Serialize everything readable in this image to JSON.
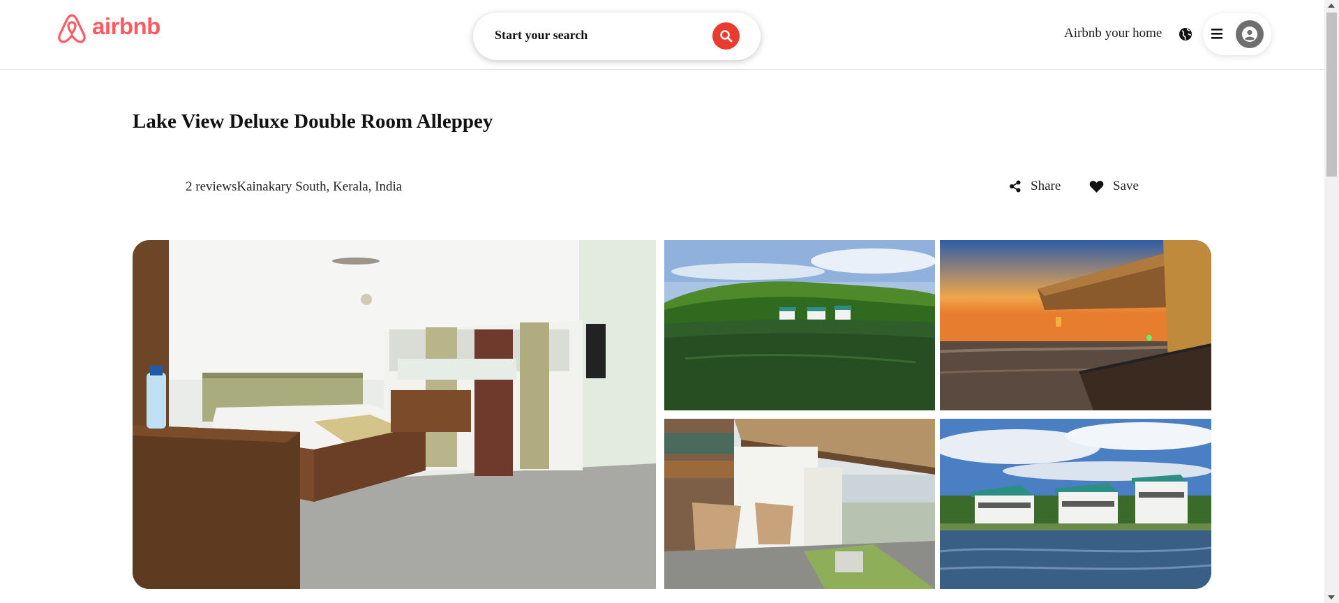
{
  "header": {
    "brand": "airbnb",
    "search_label": "Start your search",
    "host_link": "Airbnb your home"
  },
  "listing": {
    "title": "Lake View Deluxe Double Room Alleppey",
    "reviews": "2 reviews",
    "location": "Kainakary South, Kerala, India",
    "share_label": "Share",
    "save_label": "Save"
  },
  "icons": {
    "logo": "airbnb-logo-icon",
    "search": "search-icon",
    "globe": "globe-icon",
    "menu": "hamburger-menu-icon",
    "avatar": "user-avatar-icon",
    "share": "share-icon",
    "save": "heart-icon"
  },
  "colors": {
    "brand": "#ff5a5f",
    "search_button": "#ea3b2f",
    "avatar_bg": "#6e6e6e"
  }
}
